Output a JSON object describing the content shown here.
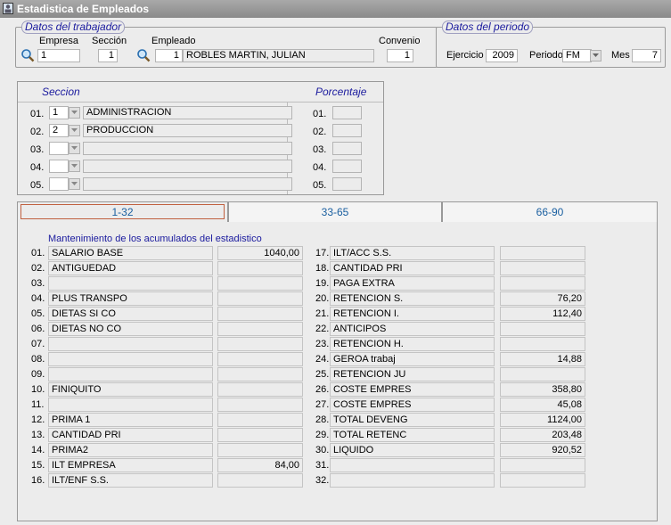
{
  "window": {
    "title": "Estadistica de Empleados",
    "icon": "employee-window-icon"
  },
  "trabajador": {
    "legend": "Datos del trabajador",
    "empresa_label": "Empresa",
    "empresa_value": "1",
    "seccion_label": "Sección",
    "seccion_value": "1",
    "empleado_label": "Empleado",
    "empleado_code": "1",
    "empleado_name": "ROBLES MARTIN, JULIAN",
    "convenio_label": "Convenio",
    "convenio_value": "1"
  },
  "periodo": {
    "legend": "Datos del periodo",
    "ejercicio_label": "Ejercicio",
    "ejercicio_value": "2009",
    "periodo_label": "Periodo",
    "periodo_value": "FM",
    "mes_label": "Mes",
    "mes_value": "7"
  },
  "secciones": {
    "seccion_header": "Seccion",
    "porcentaje_header": "Porcentaje",
    "rows": [
      {
        "num": "01.",
        "code": "1",
        "name": "ADMINISTRACION",
        "pnum": "01.",
        "pct": ""
      },
      {
        "num": "02.",
        "code": "2",
        "name": "PRODUCCION",
        "pnum": "02.",
        "pct": ""
      },
      {
        "num": "03.",
        "code": "",
        "name": "",
        "pnum": "03.",
        "pct": ""
      },
      {
        "num": "04.",
        "code": "",
        "name": "",
        "pnum": "04.",
        "pct": ""
      },
      {
        "num": "05.",
        "code": "",
        "name": "",
        "pnum": "05.",
        "pct": ""
      }
    ]
  },
  "tabs": [
    {
      "label": "1-32"
    },
    {
      "label": "33-65"
    },
    {
      "label": "66-90"
    }
  ],
  "acumulados": {
    "subtitle": "Mantenimiento de los acumulados del estadistico",
    "left": [
      {
        "num": "01.",
        "concept": "SALARIO BASE",
        "value": "1040,00"
      },
      {
        "num": "02.",
        "concept": "ANTIGUEDAD",
        "value": ""
      },
      {
        "num": "03.",
        "concept": "",
        "value": ""
      },
      {
        "num": "04.",
        "concept": "PLUS TRANSPO",
        "value": ""
      },
      {
        "num": "05.",
        "concept": "DIETAS SI CO",
        "value": ""
      },
      {
        "num": "06.",
        "concept": "DIETAS NO CO",
        "value": ""
      },
      {
        "num": "07.",
        "concept": "",
        "value": ""
      },
      {
        "num": "08.",
        "concept": "",
        "value": ""
      },
      {
        "num": "09.",
        "concept": "",
        "value": ""
      },
      {
        "num": "10.",
        "concept": "FINIQUITO",
        "value": ""
      },
      {
        "num": "11.",
        "concept": "",
        "value": ""
      },
      {
        "num": "12.",
        "concept": "PRIMA 1",
        "value": ""
      },
      {
        "num": "13.",
        "concept": "CANTIDAD PRI",
        "value": ""
      },
      {
        "num": "14.",
        "concept": "PRIMA2",
        "value": ""
      },
      {
        "num": "15.",
        "concept": "ILT EMPRESA",
        "value": "84,00"
      },
      {
        "num": "16.",
        "concept": "ILT/ENF S.S.",
        "value": ""
      }
    ],
    "right": [
      {
        "num": "17.",
        "concept": "ILT/ACC S.S.",
        "value": ""
      },
      {
        "num": "18.",
        "concept": "CANTIDAD PRI",
        "value": ""
      },
      {
        "num": "19.",
        "concept": "PAGA EXTRA",
        "value": ""
      },
      {
        "num": "20.",
        "concept": "RETENCION S.",
        "value": "76,20"
      },
      {
        "num": "21.",
        "concept": "RETENCION I.",
        "value": "112,40"
      },
      {
        "num": "22.",
        "concept": "ANTICIPOS",
        "value": ""
      },
      {
        "num": "23.",
        "concept": "RETENCION H.",
        "value": ""
      },
      {
        "num": "24.",
        "concept": "GEROA trabaj",
        "value": "14,88"
      },
      {
        "num": "25.",
        "concept": "RETENCION JU",
        "value": ""
      },
      {
        "num": "26.",
        "concept": "COSTE EMPRES",
        "value": "358,80"
      },
      {
        "num": "27.",
        "concept": "COSTE EMPRES",
        "value": "45,08"
      },
      {
        "num": "28.",
        "concept": "TOTAL DEVENG",
        "value": "1124,00"
      },
      {
        "num": "29.",
        "concept": "TOTAL RETENC",
        "value": "203,48"
      },
      {
        "num": "30.",
        "concept": "LIQUIDO",
        "value": "920,52"
      },
      {
        "num": "31.",
        "concept": "",
        "value": ""
      },
      {
        "num": "32.",
        "concept": "",
        "value": ""
      }
    ]
  }
}
